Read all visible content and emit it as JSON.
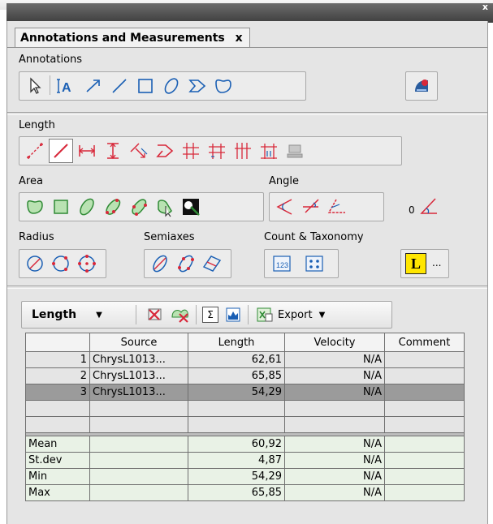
{
  "panel": {
    "tab_title": "Annotations and Measurements",
    "tab_close": "x"
  },
  "sections": {
    "annotations": "Annotations",
    "length": "Length",
    "area": "Area",
    "angle": "Angle",
    "angle_value": "0",
    "radius": "Radius",
    "semiaxes": "Semiaxes",
    "count_taxonomy": "Count & Taxonomy",
    "count_icon_text": "123",
    "taxonomy_letter": "L",
    "more": "..."
  },
  "toolbar": {
    "mode": "Length",
    "sigma": "Σ",
    "export": "Export"
  },
  "table": {
    "headers": [
      "",
      "Source",
      "Length",
      "Velocity",
      "Comment"
    ],
    "rows": [
      {
        "idx": "1",
        "source": "ChrysL1013...",
        "length": "62,61",
        "velocity": "N/A",
        "comment": ""
      },
      {
        "idx": "2",
        "source": "ChrysL1013...",
        "length": "65,85",
        "velocity": "N/A",
        "comment": ""
      },
      {
        "idx": "3",
        "source": "ChrysL1013...",
        "length": "54,29",
        "velocity": "N/A",
        "comment": ""
      }
    ],
    "stats": [
      {
        "label": "Mean",
        "length": "60,92",
        "velocity": "N/A"
      },
      {
        "label": "St.dev",
        "length": "4,87",
        "velocity": "N/A"
      },
      {
        "label": "Min",
        "length": "54,29",
        "velocity": "N/A"
      },
      {
        "label": "Max",
        "length": "65,85",
        "velocity": "N/A"
      }
    ]
  },
  "colors": {
    "tool_red": "#d8283a",
    "tool_green": "#2f8a35",
    "tool_blue": "#1a5fb4",
    "selected_row": "#9b9b9b",
    "stats_bg": "#e9f2e6",
    "taxonomy_yellow": "#ffe600"
  }
}
